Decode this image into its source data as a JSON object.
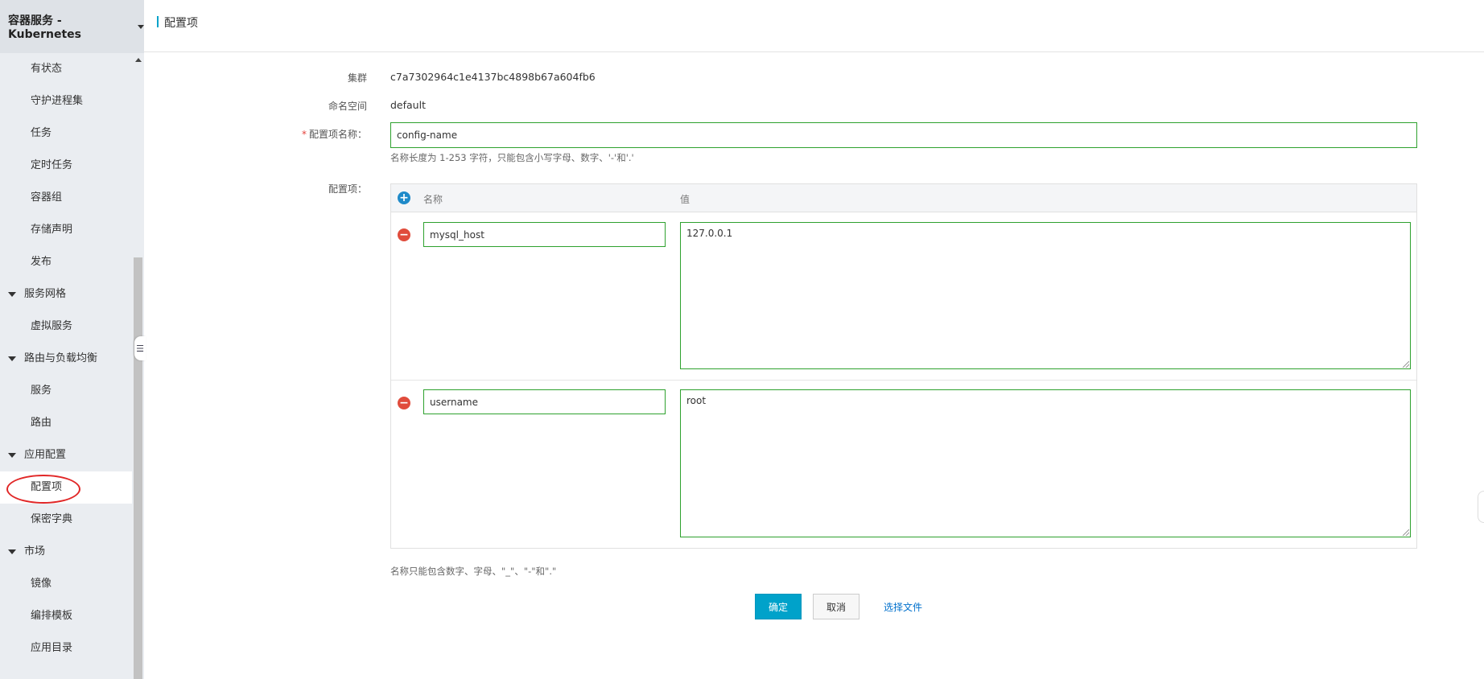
{
  "sidebar": {
    "title": "容器服务 - Kubernetes",
    "items": [
      {
        "type": "item",
        "label": "有状态"
      },
      {
        "type": "item",
        "label": "守护进程集"
      },
      {
        "type": "item",
        "label": "任务"
      },
      {
        "type": "item",
        "label": "定时任务"
      },
      {
        "type": "item",
        "label": "容器组"
      },
      {
        "type": "item",
        "label": "存储声明"
      },
      {
        "type": "item",
        "label": "发布"
      },
      {
        "type": "group",
        "label": "服务网格"
      },
      {
        "type": "item",
        "label": "虚拟服务"
      },
      {
        "type": "group",
        "label": "路由与负载均衡"
      },
      {
        "type": "item",
        "label": "服务"
      },
      {
        "type": "item",
        "label": "路由"
      },
      {
        "type": "group",
        "label": "应用配置"
      },
      {
        "type": "item",
        "label": "配置项",
        "active": true
      },
      {
        "type": "item",
        "label": "保密字典"
      },
      {
        "type": "group",
        "label": "市场"
      },
      {
        "type": "item",
        "label": "镜像"
      },
      {
        "type": "item",
        "label": "编排模板"
      },
      {
        "type": "item",
        "label": "应用目录"
      }
    ]
  },
  "header": {
    "title": "配置项"
  },
  "form": {
    "cluster_label": "集群",
    "cluster_value": "c7a7302964c1e4137bc4898b67a604fb6",
    "namespace_label": "命名空间",
    "namespace_value": "default",
    "name_label": "配置项名称：",
    "name_required": "*",
    "name_value": "config-name",
    "name_hint": "名称长度为 1-253 字符，只能包含小写字母、数字、'-'和'.'",
    "items_label": "配置项：",
    "table": {
      "col_name": "名称",
      "col_value": "值",
      "rows": [
        {
          "name": "mysql_host",
          "value": "127.0.0.1"
        },
        {
          "name": "username",
          "value": "root"
        }
      ]
    },
    "items_hint": "名称只能包含数字、字母、\"_\"、\"-\"和\".\"",
    "confirm_label": "确定",
    "cancel_label": "取消",
    "select_file_label": "选择文件"
  },
  "colors": {
    "accent": "#00a2ca",
    "input_border": "#2ea12e",
    "annotation_circle": "#e12727"
  }
}
